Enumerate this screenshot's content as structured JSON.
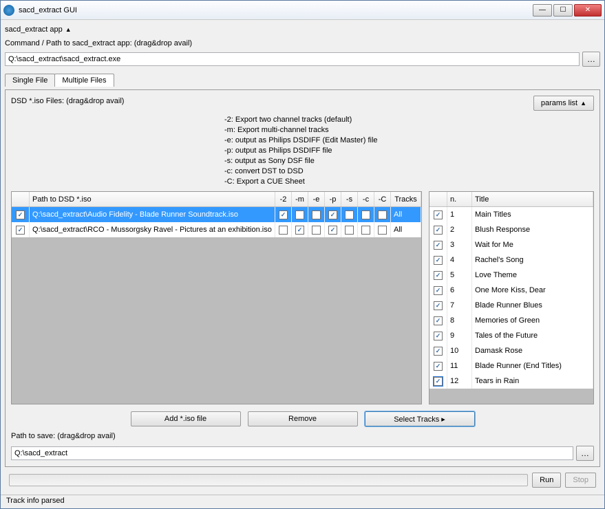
{
  "window": {
    "title": "sacd_extract GUI"
  },
  "section_app": "sacd_extract app",
  "path_label": "Command / Path to sacd_extract app: (drag&drop avail)",
  "app_path": "Q:\\sacd_extract\\sacd_extract.exe",
  "tabs": {
    "single": "Single File",
    "multiple": "Multiple Files"
  },
  "dsd_label": "DSD *.iso Files: (drag&drop avail)",
  "params_btn": "params list",
  "help": [
    "-2: Export two channel tracks (default)",
    "-m: Export multi-channel tracks",
    "-e: output as Philips DSDIFF (Edit Master) file",
    "-p: output as Philips DSDIFF file",
    "-s: output as Sony DSF file",
    "-c: convert DST to DSD",
    "-C: Export a CUE Sheet"
  ],
  "iso_columns": {
    "path": "Path to DSD *.iso",
    "f2": "-2",
    "fm": "-m",
    "fe": "-e",
    "fp": "-p",
    "fs": "-s",
    "fc": "-c",
    "fC": "-C",
    "tracks": "Tracks"
  },
  "iso_rows": [
    {
      "checked": true,
      "selected": true,
      "path": "Q:\\sacd_extract\\Audio Fidelity - Blade Runner Soundtrack.iso",
      "flags": {
        "2": true,
        "m": false,
        "e": false,
        "p": true,
        "s": false,
        "c": false,
        "C": false
      },
      "tracks": "All"
    },
    {
      "checked": true,
      "selected": false,
      "path": "Q:\\sacd_extract\\RCO - Mussorgsky Ravel - Pictures at an exhibition.iso",
      "flags": {
        "2": false,
        "m": true,
        "e": false,
        "p": true,
        "s": false,
        "c": false,
        "C": false
      },
      "tracks": "All"
    }
  ],
  "track_columns": {
    "n": "n.",
    "title": "Title"
  },
  "tracks": [
    {
      "checked": true,
      "n": "1",
      "title": "Main Titles"
    },
    {
      "checked": true,
      "n": "2",
      "title": "Blush Response"
    },
    {
      "checked": true,
      "n": "3",
      "title": "Wait for Me"
    },
    {
      "checked": true,
      "n": "4",
      "title": "Rachel's Song"
    },
    {
      "checked": true,
      "n": "5",
      "title": "Love Theme"
    },
    {
      "checked": true,
      "n": "6",
      "title": "One More Kiss, Dear"
    },
    {
      "checked": true,
      "n": "7",
      "title": "Blade Runner Blues"
    },
    {
      "checked": true,
      "n": "8",
      "title": "Memories of Green"
    },
    {
      "checked": true,
      "n": "9",
      "title": "Tales of the Future"
    },
    {
      "checked": true,
      "n": "10",
      "title": "Damask Rose"
    },
    {
      "checked": true,
      "n": "11",
      "title": "Blade Runner (End Titles)"
    },
    {
      "checked": true,
      "n": "12",
      "title": "Tears in Rain"
    }
  ],
  "buttons": {
    "add": "Add *.iso file",
    "remove": "Remove",
    "select": "Select Tracks ▸"
  },
  "save_label": "Path to save: (drag&drop avail)",
  "save_path": "Q:\\sacd_extract",
  "run": "Run",
  "stop": "Stop",
  "status": "Track info parsed"
}
